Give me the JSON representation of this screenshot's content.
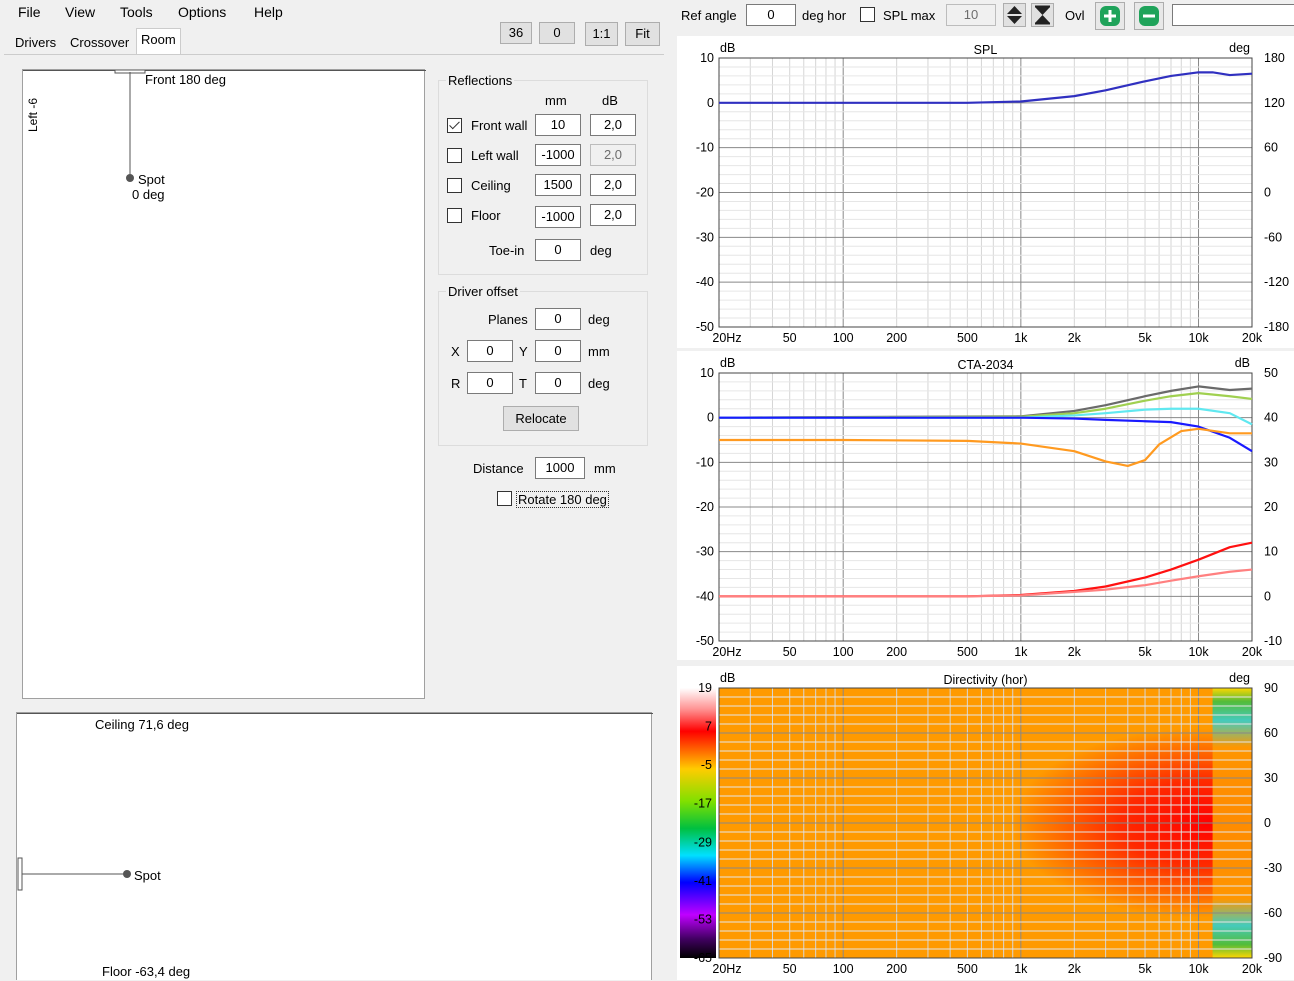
{
  "menu": [
    "File",
    "View",
    "Tools",
    "Options",
    "Help"
  ],
  "tabs": [
    "Drivers",
    "Crossover",
    "Room"
  ],
  "active_tab": "Room",
  "toolbar": {
    "buttons": [
      "36",
      "0",
      "1:1",
      "Fit"
    ],
    "ref_angle_label": "Ref angle",
    "ref_angle_value": "0",
    "deg_hor_label": "deg hor",
    "spl_max_label": "SPL max",
    "spl_max_value": "10",
    "ovl_label": "Ovl",
    "text_value": ""
  },
  "top_view": {
    "left_label": "Left -6",
    "front_label": "Front 180 deg",
    "spot_label": "Spot",
    "spot_deg": "0 deg"
  },
  "side_view": {
    "ceiling_label": "Ceiling 71,6 deg",
    "spot_label": "Spot",
    "floor_label": "Floor -63,4 deg"
  },
  "reflections": {
    "title": "Reflections",
    "col_mm": "mm",
    "col_db": "dB",
    "rows": [
      {
        "label": "Front wall",
        "checked": true,
        "mm": "10",
        "db": "2,0",
        "db_disabled": false
      },
      {
        "label": "Left wall",
        "checked": false,
        "mm": "-1000",
        "db": "2,0",
        "db_disabled": true
      },
      {
        "label": "Ceiling",
        "checked": false,
        "mm": "1500",
        "db": "2,0",
        "db_disabled": false
      },
      {
        "label": "Floor",
        "checked": false,
        "mm": "-1000",
        "db": "2,0",
        "db_disabled": false
      }
    ],
    "toein_label": "Toe-in",
    "toein_value": "0",
    "toein_unit": "deg"
  },
  "driver_offset": {
    "title": "Driver offset",
    "planes_label": "Planes",
    "planes_value": "0",
    "planes_unit": "deg",
    "x_label": "X",
    "x_value": "0",
    "y_label": "Y",
    "y_value": "0",
    "xy_unit": "mm",
    "r_label": "R",
    "r_value": "0",
    "t_label": "T",
    "t_value": "0",
    "rt_unit": "deg",
    "relocate_label": "Relocate"
  },
  "distance": {
    "label": "Distance",
    "value": "1000",
    "unit": "mm"
  },
  "rotate_label": "Rotate 180 deg",
  "freq_ticks": [
    "20Hz",
    "50",
    "100",
    "200",
    "500",
    "1k",
    "2k",
    "5k",
    "10k",
    "20k"
  ],
  "colors": {
    "spl": "#3030c0",
    "cta_on_axis": "#1a1aff",
    "cta_listening": "#a0d050",
    "cta_early": "#60e8f0",
    "cta_sound_power": "#ff9a20",
    "cta_total": "#6a6a6a",
    "cta_er_di": "#ff1010",
    "cta_sp_di": "#ff8080",
    "directivity_base": "#ff9a00"
  },
  "chart_data": [
    {
      "type": "line",
      "title": "SPL",
      "ylabel": "dB",
      "y2label": "deg",
      "x_scale": "log",
      "xlim": [
        20,
        20000
      ],
      "ylim": [
        -50,
        10
      ],
      "y_ticks": [
        "10",
        "0",
        "-10",
        "-20",
        "-30",
        "-40",
        "-50"
      ],
      "y2_ticks": [
        "180",
        "120",
        "60",
        "0",
        "-60",
        "-120",
        "-180"
      ],
      "series": [
        {
          "x": [
            20,
            100,
            500,
            1000,
            2000,
            3000,
            5000,
            7000,
            10000,
            12000,
            15000,
            20000
          ],
          "y": [
            0,
            0,
            0,
            0.3,
            1.5,
            2.8,
            4.8,
            6.0,
            6.8,
            6.8,
            6.2,
            6.5
          ]
        }
      ]
    },
    {
      "type": "line",
      "title": "CTA-2034",
      "ylabel": "dB",
      "y2label": "dB",
      "x_scale": "log",
      "xlim": [
        20,
        20000
      ],
      "ylim": [
        -50,
        10
      ],
      "y_ticks": [
        "10",
        "0",
        "-10",
        "-20",
        "-30",
        "-40",
        "-50"
      ],
      "y2_ticks": [
        "50",
        "40",
        "30",
        "20",
        "10",
        "0",
        "-10"
      ],
      "series": [
        {
          "x": [
            20,
            1000,
            2000,
            3000,
            5000,
            7000,
            10000,
            15000,
            20000
          ],
          "y": [
            0,
            0.3,
            1.5,
            2.8,
            4.8,
            6.0,
            7.0,
            6.2,
            6.5
          ]
        },
        {
          "x": [
            20,
            1000,
            2000,
            3000,
            5000,
            7000,
            10000,
            15000,
            20000
          ],
          "y": [
            0,
            0.2,
            1.0,
            2.0,
            3.8,
            4.8,
            5.5,
            4.8,
            4.2
          ]
        },
        {
          "x": [
            20,
            1000,
            2000,
            3000,
            5000,
            7000,
            10000,
            15000,
            20000
          ],
          "y": [
            0,
            0,
            0.5,
            1.0,
            1.8,
            2.0,
            2.0,
            1.0,
            -1.5
          ]
        },
        {
          "x": [
            20,
            1000,
            2000,
            3000,
            5000,
            7000,
            10000,
            15000,
            20000
          ],
          "y": [
            0,
            0,
            -0.2,
            -0.5,
            -0.8,
            -1.0,
            -2.0,
            -4.5,
            -7.5
          ]
        },
        {
          "x": [
            20,
            100,
            500,
            1000,
            2000,
            3000,
            4000,
            5000,
            6000,
            8000,
            10000,
            15000,
            20000
          ],
          "y": [
            -5,
            -5,
            -5.2,
            -5.8,
            -7.5,
            -9.8,
            -10.8,
            -9.5,
            -6.0,
            -3.0,
            -2.5,
            -3.5,
            -3.5
          ]
        },
        {
          "x": [
            20,
            100,
            500,
            1000,
            2000,
            3000,
            5000,
            7000,
            10000,
            15000,
            20000
          ],
          "y": [
            -40,
            -40,
            -40,
            -39.7,
            -38.8,
            -37.8,
            -35.8,
            -34.0,
            -31.8,
            -29.0,
            -28.0
          ]
        },
        {
          "x": [
            20,
            100,
            500,
            1000,
            2000,
            3000,
            5000,
            7000,
            10000,
            15000,
            20000
          ],
          "y": [
            -40,
            -40,
            -40,
            -39.8,
            -39.0,
            -38.5,
            -37.5,
            -36.5,
            -35.5,
            -34.5,
            -34.0
          ]
        }
      ]
    },
    {
      "type": "heatmap",
      "title": "Directivity (hor)",
      "ylabel": "dB",
      "y2label": "deg",
      "x_scale": "log",
      "xlim": [
        20,
        20000
      ],
      "ylim": [
        -90,
        90
      ],
      "y2_ticks": [
        "90",
        "60",
        "30",
        "0",
        "-30",
        "-60",
        "-90"
      ],
      "colorbar_ticks": [
        "19",
        "7",
        "-5",
        "-17",
        "-29",
        "-41",
        "-53",
        "-65"
      ]
    }
  ]
}
